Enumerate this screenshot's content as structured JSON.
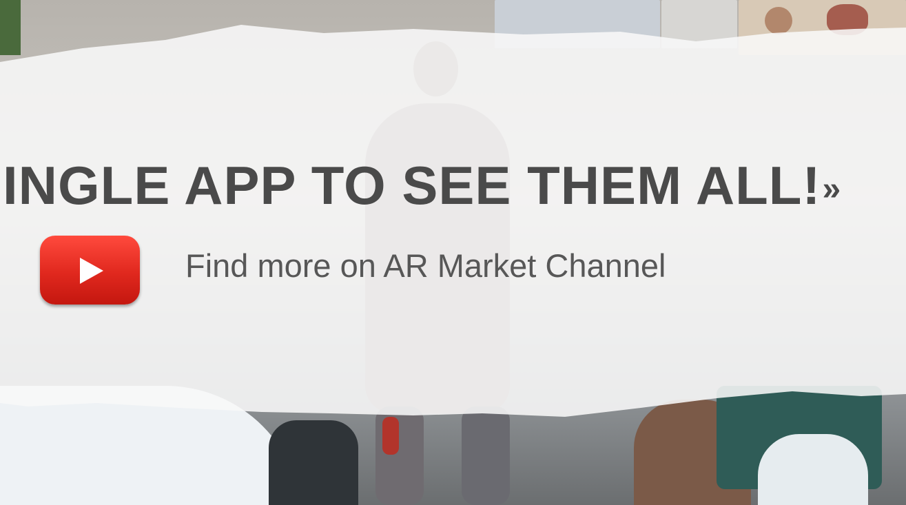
{
  "banner": {
    "headline": "INGLE APP TO SEE THEM ALL!",
    "headline_suffix": "»",
    "youtube": {
      "icon": "youtube-play-icon",
      "link_text": "Find more on AR Market Channel",
      "color": "#e52d27"
    }
  }
}
